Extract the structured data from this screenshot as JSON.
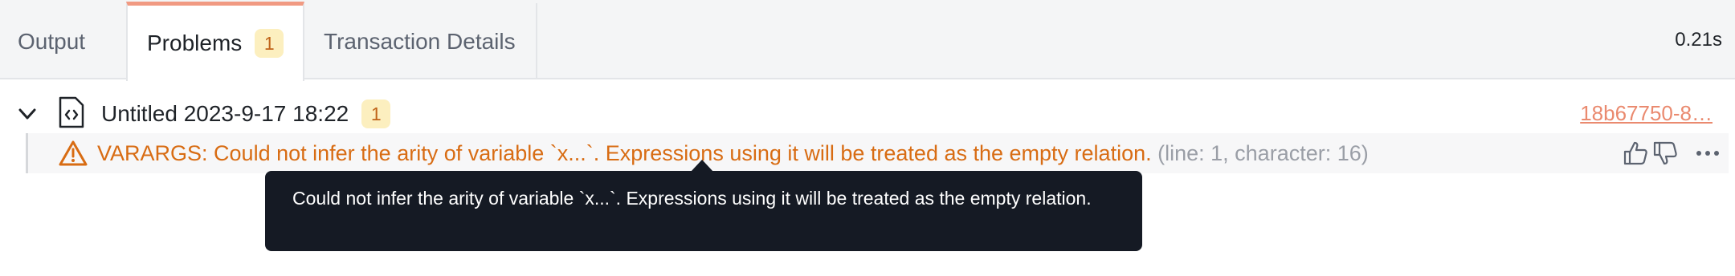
{
  "tabs": {
    "output_label": "Output",
    "problems_label": "Problems",
    "problems_count": "1",
    "details_label": "Transaction Details"
  },
  "duration": "0.21s",
  "file": {
    "name": "Untitled 2023-9-17 18:22",
    "problem_count": "1",
    "link": "18b67750-8…"
  },
  "problem": {
    "code": "VARARGS:",
    "message": "Could not infer the arity of variable `x...`. Expressions using it will be treated as the empty relation.",
    "location": "(line: 1, character: 16)"
  },
  "tooltip": {
    "text": "Could not infer the arity of variable `x...`. Expressions using it will be treated as the empty relation."
  },
  "icons": {
    "chevron": "chevron-down-icon",
    "file": "code-file-icon",
    "warning": "warning-triangle-icon",
    "thumbs_up": "thumbs-up-icon",
    "thumbs_down": "thumbs-down-icon",
    "more": "more-horizontal-icon"
  },
  "colors": {
    "accent_tab": "#f19a82",
    "badge_bg": "#fcefbf",
    "badge_text": "#c0641a",
    "warning": "#d86c13",
    "link": "#ea8a6f",
    "tooltip_bg": "#151a24"
  }
}
